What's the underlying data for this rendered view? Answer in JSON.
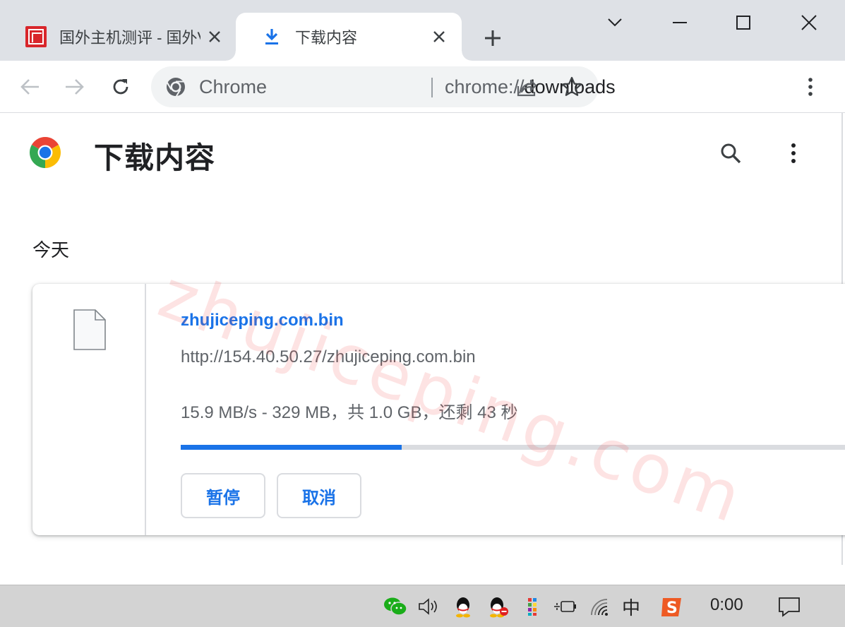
{
  "tabs": [
    {
      "title": "国外主机测评 - 国外VPS",
      "active": false,
      "icon": "seal-favicon-icon"
    },
    {
      "title": "下载内容",
      "active": true,
      "icon": "download-icon"
    }
  ],
  "window_controls": [
    "tab-search-icon",
    "minimize-icon",
    "maximize-icon",
    "close-icon"
  ],
  "omnibox": {
    "site_label": "Chrome",
    "url_scheme": "chrome://",
    "url_host": "downloads"
  },
  "page": {
    "title": "下载内容",
    "date_heading": "今天"
  },
  "download": {
    "file_name": "zhujiceping.com.bin",
    "url": "http://154.40.50.27/zhujiceping.com.bin",
    "status": "15.9 MB/s - 329 MB，共 1.0 GB，还剩 43 秒",
    "progress_fraction": 0.329,
    "pause_label": "暂停",
    "cancel_label": "取消"
  },
  "watermark": "zhujiceping.com",
  "taskbar": {
    "ime_label": "中",
    "clock": "0:00"
  },
  "colors": {
    "accent": "#1a73e8",
    "tabstrip": "#dee1e6",
    "taskbar": "#d3d3d3"
  }
}
